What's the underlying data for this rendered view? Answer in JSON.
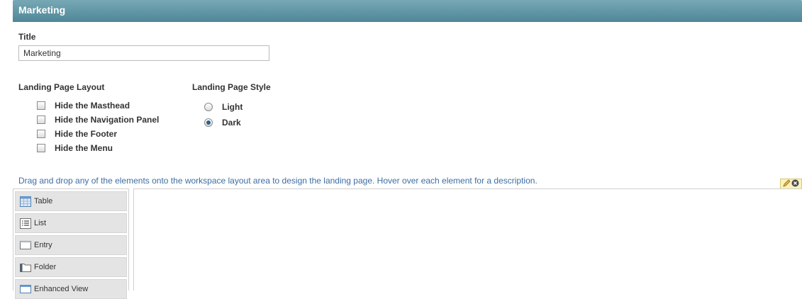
{
  "header": {
    "title": "Marketing"
  },
  "form": {
    "title_label": "Title",
    "title_value": "Marketing"
  },
  "layout_section": {
    "heading": "Landing Page Layout",
    "options": [
      {
        "label": "Hide the Masthead",
        "checked": false
      },
      {
        "label": "Hide the Navigation Panel",
        "checked": false
      },
      {
        "label": "Hide the Footer",
        "checked": false
      },
      {
        "label": "Hide the Menu",
        "checked": false
      }
    ]
  },
  "style_section": {
    "heading": "Landing Page Style",
    "options": [
      {
        "label": "Light",
        "selected": false
      },
      {
        "label": "Dark",
        "selected": true
      }
    ]
  },
  "instructions": "Drag and drop any of the elements onto the workspace layout area to design the landing page. Hover over each element for a description.",
  "edit_tools": {
    "edit_icon": "pencil-icon",
    "close_icon": "close-icon"
  },
  "palette": {
    "items": [
      {
        "label": "Table",
        "icon": "table-icon"
      },
      {
        "label": "List",
        "icon": "list-icon"
      },
      {
        "label": "Entry",
        "icon": "entry-icon"
      },
      {
        "label": "Folder",
        "icon": "folder-icon"
      },
      {
        "label": "Enhanced View",
        "icon": "enhanced-view-icon"
      }
    ]
  }
}
